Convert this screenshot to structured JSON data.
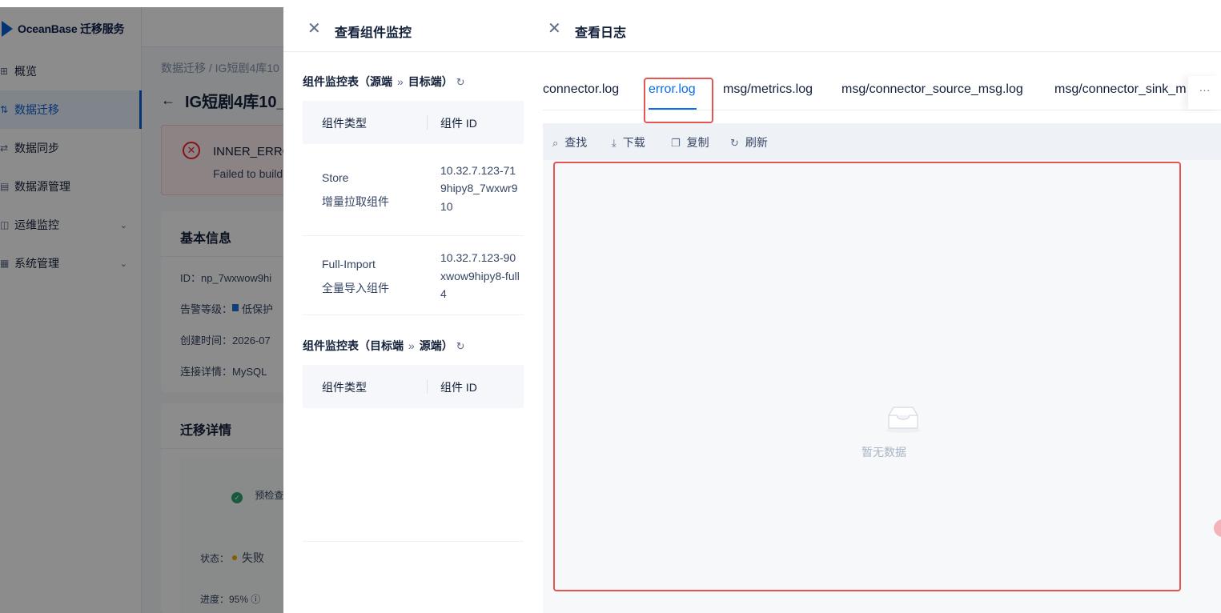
{
  "app": {
    "logo_text": "OceanBase 迁移服务",
    "nav": [
      {
        "label": "概览",
        "icon": "grid-icon",
        "active": false
      },
      {
        "label": "数据迁移",
        "icon": "migration-icon",
        "active": true
      },
      {
        "label": "数据同步",
        "icon": "sync-icon",
        "active": false
      },
      {
        "label": "数据源管理",
        "icon": "datasource-icon",
        "active": false
      },
      {
        "label": "运维监控",
        "icon": "monitor-icon",
        "active": false,
        "expandable": true
      },
      {
        "label": "系统管理",
        "icon": "settings-icon",
        "active": false,
        "expandable": true
      }
    ],
    "breadcrumb": "数据迁移 / IG短剧4库10",
    "page_title": "IG短剧4库10_",
    "error": {
      "code": "INNER_ERRO",
      "desc": "Failed to build"
    },
    "basic_info": {
      "title": "基本信息",
      "id": "ID：np_7wxwow9hi",
      "alert_level": "告警等级：",
      "alert_value": "低保护",
      "created": "创建时间：2026-07",
      "connection": "连接详情：MySQL"
    },
    "migration": {
      "title": "迁移详情",
      "precheck": "预检查",
      "status_label": "状态：",
      "status_value": "失败",
      "progress": "进度：95%"
    }
  },
  "monitor_drawer": {
    "title": "查看组件监控",
    "section1": {
      "left": "组件监控表（源端",
      "arrow": "»",
      "right": "目标端）"
    },
    "section2": {
      "left": "组件监控表（目标端",
      "arrow": "»",
      "right": "源端）"
    },
    "headers": {
      "type": "组件类型",
      "id": "组件 ID"
    },
    "rows": [
      {
        "type1": "Store",
        "type2": "增量拉取组件",
        "id1": "10.32.7.123-71",
        "id2": "9hipy8_7wxwr9",
        "id3": "10"
      },
      {
        "type1": "Full-Import",
        "type2": "全量导入组件",
        "id1": "10.32.7.123-90",
        "id2": "xwow9hipy8-full",
        "id3": "4"
      }
    ]
  },
  "log_drawer": {
    "title": "查看日志",
    "tabs": [
      "connector.log",
      "error.log",
      "msg/metrics.log",
      "msg/connector_source_msg.log",
      "msg/connector_sink_m"
    ],
    "active_tab": "error.log",
    "more": "···",
    "toolbar": {
      "find": "查找",
      "download": "下载",
      "copy": "复制",
      "refresh": "刷新"
    },
    "empty_text": "暂无数据"
  },
  "colors": {
    "primary": "#0b6ee8",
    "highlight": "#e55353",
    "error": "#f5222d"
  }
}
